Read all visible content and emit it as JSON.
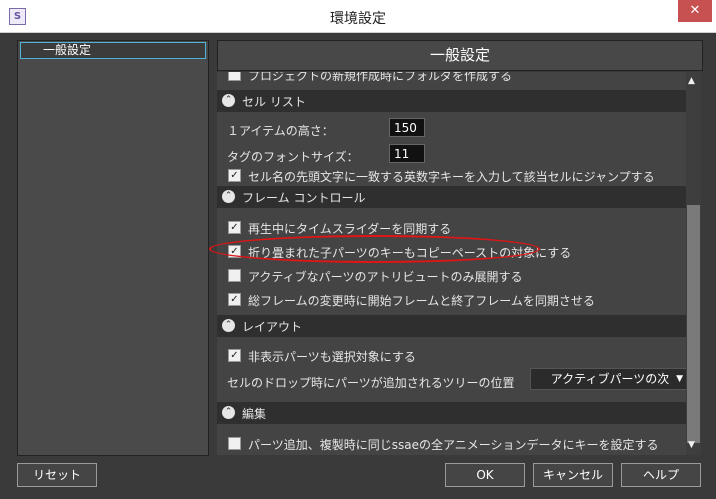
{
  "window": {
    "title": "環境設定",
    "close_glyph": "✕",
    "app_icon_glyph": "S"
  },
  "sidebar": {
    "items": [
      {
        "label": "一般設定"
      }
    ]
  },
  "header": {
    "title": "一般設定"
  },
  "content": {
    "top_cut_label": "プロジェクトの新規作成時にフォルダを作成する",
    "cell_list": {
      "title": "セル リスト",
      "item_height_label": "１アイテムの高さ：",
      "item_height_value": "150",
      "tag_font_label": "タグのフォントサイズ：",
      "tag_font_value": "11",
      "jump_label": "セル名の先頭文字に一致する英数字キーを入力して該当セルにジャンプする"
    },
    "frame_control": {
      "title": "フレーム コントロール",
      "sync_label": "再生中にタイムスライダーを同期する",
      "copy_paste_label": "折り畳まれた子パーツのキーもコピーペーストの対象にする",
      "active_attr_label": "アクティブなパーツのアトリビュートのみ展開する",
      "sync_total_label": "総フレームの変更時に開始フレームと終了フレームを同期させる"
    },
    "layout": {
      "title": "レイアウト",
      "hidden_select_label": "非表示パーツも選択対象にする",
      "drop_position_label": "セルのドロップ時にパーツが追加されるツリーの位置",
      "drop_position_value": "アクティブパーツの次"
    },
    "edit": {
      "title": "編集",
      "ssae_key_label": "パーツ追加、複製時に同じssaeの全アニメーションデータにキーを設定する"
    }
  },
  "buttons": {
    "reset": "リセット",
    "ok": "OK",
    "cancel": "キャンセル",
    "help": "ヘルプ"
  },
  "glyphs": {
    "check": "✓",
    "collapse": "⌃",
    "down_arrow": "▼",
    "up_arrow": "▲"
  },
  "colors": {
    "highlight_oval": "#e01515",
    "selection_border": "#4fb3d6",
    "close_button": "#c75050"
  }
}
